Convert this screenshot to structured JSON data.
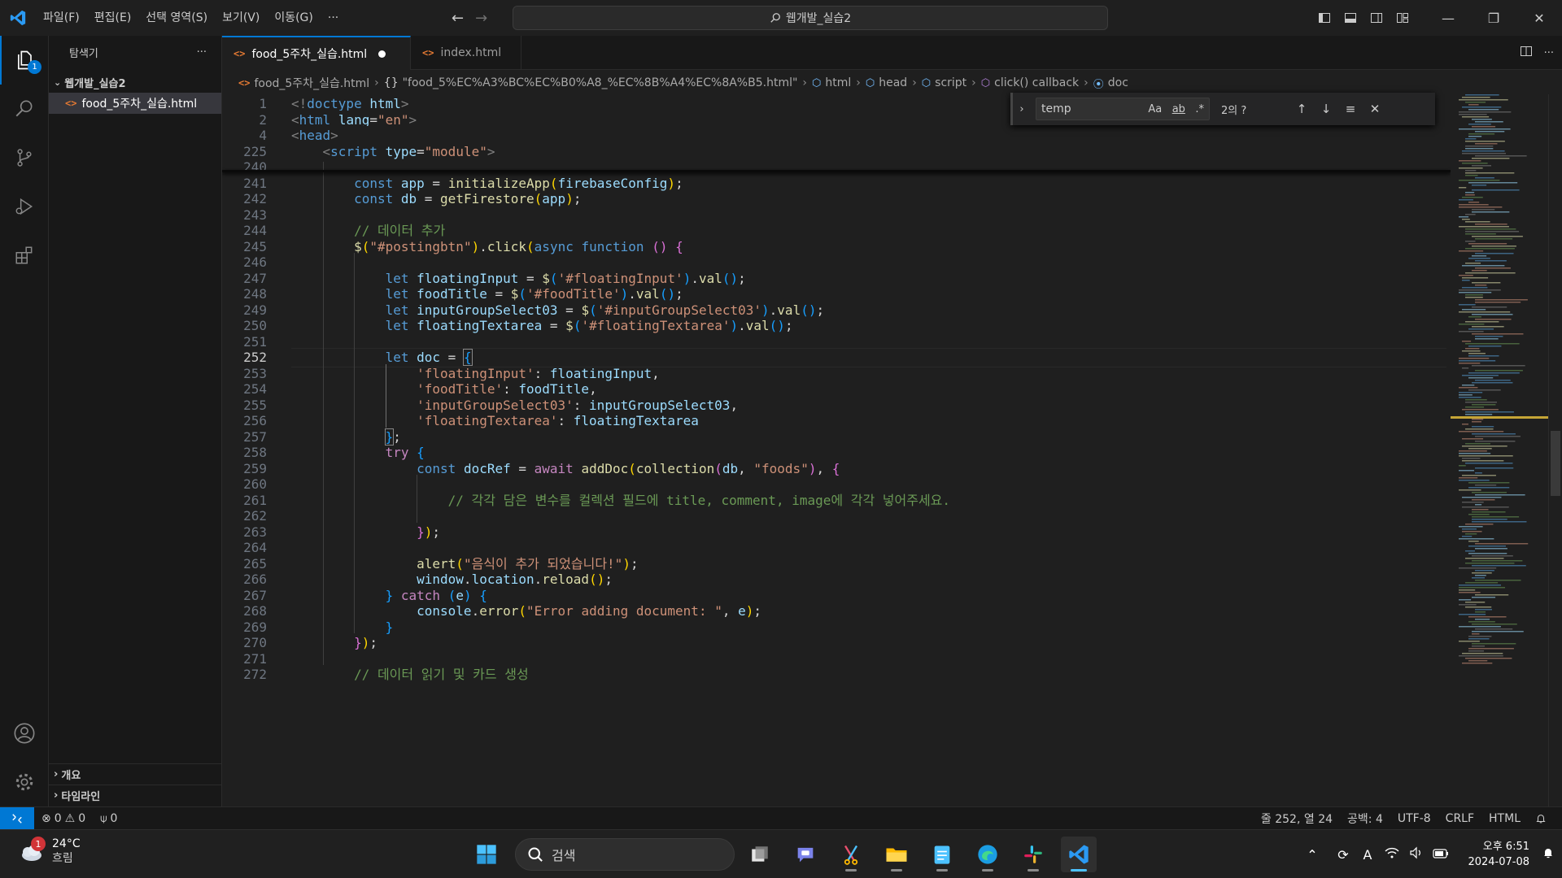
{
  "titlebar": {
    "menu": [
      "파일(F)",
      "편집(E)",
      "선택 영역(S)",
      "보기(V)",
      "이동(G)"
    ],
    "more": "···",
    "command_center": "웹개발_실습2"
  },
  "activitybar": {
    "explorer_badge": "1"
  },
  "sidebar": {
    "title": "탐색기",
    "more": "···",
    "folder": "웹개발_실습2",
    "file": "food_5주차_실습.html",
    "outline": "개요",
    "timeline": "타임라인"
  },
  "tabs": [
    {
      "label": "food_5주차_실습.html",
      "dirty": true
    },
    {
      "label": "index.html",
      "dirty": false
    }
  ],
  "breadcrumb": {
    "file": "food_5주차_실습.html",
    "object": "\"food_5%EC%A3%BC%EC%B0%A8_%EC%8B%A4%EC%8A%B5.html\"",
    "html": "html",
    "head": "head",
    "script": "script",
    "callback": "click() callback",
    "doc": "doc"
  },
  "find": {
    "query": "temp",
    "match_case": "Aa",
    "whole_word": "ab",
    "regex": ".*",
    "count": "2의 ?"
  },
  "editor": {
    "current_line": 252,
    "sticky": [
      {
        "n": "1",
        "parts": [
          [
            "pun",
            "<!"
          ],
          [
            "tag",
            "doctype"
          ],
          [
            "pl",
            " "
          ],
          [
            "attr",
            "html"
          ],
          [
            "pun",
            ">"
          ]
        ]
      },
      {
        "n": "2",
        "parts": [
          [
            "pun",
            "<"
          ],
          [
            "tag",
            "html"
          ],
          [
            "pl",
            " "
          ],
          [
            "attr",
            "lang"
          ],
          [
            "pl",
            "="
          ],
          [
            "str",
            "\"en\""
          ],
          [
            "pun",
            ">"
          ]
        ]
      },
      {
        "n": "4",
        "parts": [
          [
            "pun",
            "<"
          ],
          [
            "tag",
            "head"
          ],
          [
            "pun",
            ">"
          ]
        ]
      },
      {
        "n": "225",
        "parts": [
          [
            "pl",
            "    "
          ],
          [
            "pun",
            "<"
          ],
          [
            "tag",
            "script"
          ],
          [
            "pl",
            " "
          ],
          [
            "attr",
            "type"
          ],
          [
            "pl",
            "="
          ],
          [
            "str",
            "\"module\""
          ],
          [
            "pun",
            ">"
          ]
        ]
      }
    ],
    "lines": [
      {
        "n": "240",
        "parts": []
      },
      {
        "n": "241",
        "parts": [
          [
            "pl",
            "        "
          ],
          [
            "kw",
            "const"
          ],
          [
            "pl",
            " "
          ],
          [
            "var",
            "app"
          ],
          [
            "pl",
            " = "
          ],
          [
            "fn",
            "initializeApp"
          ],
          [
            "br1",
            "("
          ],
          [
            "var",
            "firebaseConfig"
          ],
          [
            "br1",
            ")"
          ],
          [
            "pl",
            ";"
          ]
        ]
      },
      {
        "n": "242",
        "parts": [
          [
            "pl",
            "        "
          ],
          [
            "kw",
            "const"
          ],
          [
            "pl",
            " "
          ],
          [
            "var",
            "db"
          ],
          [
            "pl",
            " = "
          ],
          [
            "fn",
            "getFirestore"
          ],
          [
            "br1",
            "("
          ],
          [
            "var",
            "app"
          ],
          [
            "br1",
            ")"
          ],
          [
            "pl",
            ";"
          ]
        ]
      },
      {
        "n": "243",
        "parts": []
      },
      {
        "n": "244",
        "parts": [
          [
            "pl",
            "        "
          ],
          [
            "cm",
            "// 데이터 추가"
          ]
        ]
      },
      {
        "n": "245",
        "parts": [
          [
            "pl",
            "        "
          ],
          [
            "fn",
            "$"
          ],
          [
            "br1",
            "("
          ],
          [
            "str",
            "\"#postingbtn\""
          ],
          [
            "br1",
            ")"
          ],
          [
            "pl",
            "."
          ],
          [
            "fn",
            "click"
          ],
          [
            "br1",
            "("
          ],
          [
            "kw",
            "async"
          ],
          [
            "pl",
            " "
          ],
          [
            "kw",
            "function"
          ],
          [
            "pl",
            " "
          ],
          [
            "br2",
            "()"
          ],
          [
            "pl",
            " "
          ],
          [
            "br2",
            "{"
          ]
        ]
      },
      {
        "n": "246",
        "parts": []
      },
      {
        "n": "247",
        "parts": [
          [
            "pl",
            "            "
          ],
          [
            "kw",
            "let"
          ],
          [
            "pl",
            " "
          ],
          [
            "var",
            "floatingInput"
          ],
          [
            "pl",
            " = "
          ],
          [
            "fn",
            "$"
          ],
          [
            "br3",
            "("
          ],
          [
            "str",
            "'#floatingInput'"
          ],
          [
            "br3",
            ")"
          ],
          [
            "pl",
            "."
          ],
          [
            "fn",
            "val"
          ],
          [
            "br3",
            "()"
          ],
          [
            "pl",
            ";"
          ]
        ]
      },
      {
        "n": "248",
        "parts": [
          [
            "pl",
            "            "
          ],
          [
            "kw",
            "let"
          ],
          [
            "pl",
            " "
          ],
          [
            "var",
            "foodTitle"
          ],
          [
            "pl",
            " = "
          ],
          [
            "fn",
            "$"
          ],
          [
            "br3",
            "("
          ],
          [
            "str",
            "'#foodTitle'"
          ],
          [
            "br3",
            ")"
          ],
          [
            "pl",
            "."
          ],
          [
            "fn",
            "val"
          ],
          [
            "br3",
            "()"
          ],
          [
            "pl",
            ";"
          ]
        ]
      },
      {
        "n": "249",
        "parts": [
          [
            "pl",
            "            "
          ],
          [
            "kw",
            "let"
          ],
          [
            "pl",
            " "
          ],
          [
            "var",
            "inputGroupSelect03"
          ],
          [
            "pl",
            " = "
          ],
          [
            "fn",
            "$"
          ],
          [
            "br3",
            "("
          ],
          [
            "str",
            "'#inputGroupSelect03'"
          ],
          [
            "br3",
            ")"
          ],
          [
            "pl",
            "."
          ],
          [
            "fn",
            "val"
          ],
          [
            "br3",
            "()"
          ],
          [
            "pl",
            ";"
          ]
        ]
      },
      {
        "n": "250",
        "parts": [
          [
            "pl",
            "            "
          ],
          [
            "kw",
            "let"
          ],
          [
            "pl",
            " "
          ],
          [
            "var",
            "floatingTextarea"
          ],
          [
            "pl",
            " = "
          ],
          [
            "fn",
            "$"
          ],
          [
            "br3",
            "("
          ],
          [
            "str",
            "'#floatingTextarea'"
          ],
          [
            "br3",
            ")"
          ],
          [
            "pl",
            "."
          ],
          [
            "fn",
            "val"
          ],
          [
            "br3",
            "()"
          ],
          [
            "pl",
            ";"
          ]
        ]
      },
      {
        "n": "251",
        "parts": []
      },
      {
        "n": "252",
        "parts": [
          [
            "pl",
            "            "
          ],
          [
            "kw",
            "let"
          ],
          [
            "pl",
            " "
          ],
          [
            "var",
            "doc"
          ],
          [
            "pl",
            " = "
          ],
          [
            "br3m",
            "{"
          ]
        ]
      },
      {
        "n": "253",
        "parts": [
          [
            "pl",
            "                "
          ],
          [
            "str",
            "'floatingInput'"
          ],
          [
            "pl",
            ": "
          ],
          [
            "var",
            "floatingInput"
          ],
          [
            "pl",
            ","
          ]
        ]
      },
      {
        "n": "254",
        "parts": [
          [
            "pl",
            "                "
          ],
          [
            "str",
            "'foodTitle'"
          ],
          [
            "pl",
            ": "
          ],
          [
            "var",
            "foodTitle"
          ],
          [
            "pl",
            ","
          ]
        ]
      },
      {
        "n": "255",
        "parts": [
          [
            "pl",
            "                "
          ],
          [
            "str",
            "'inputGroupSelect03'"
          ],
          [
            "pl",
            ": "
          ],
          [
            "var",
            "inputGroupSelect03"
          ],
          [
            "pl",
            ","
          ]
        ]
      },
      {
        "n": "256",
        "parts": [
          [
            "pl",
            "                "
          ],
          [
            "str",
            "'floatingTextarea'"
          ],
          [
            "pl",
            ": "
          ],
          [
            "var",
            "floatingTextarea"
          ]
        ]
      },
      {
        "n": "257",
        "parts": [
          [
            "pl",
            "            "
          ],
          [
            "br3m",
            "}"
          ],
          [
            "pl",
            ";"
          ]
        ]
      },
      {
        "n": "258",
        "parts": [
          [
            "pl",
            "            "
          ],
          [
            "ctl",
            "try"
          ],
          [
            "pl",
            " "
          ],
          [
            "br3",
            "{"
          ]
        ]
      },
      {
        "n": "259",
        "parts": [
          [
            "pl",
            "                "
          ],
          [
            "kw",
            "const"
          ],
          [
            "pl",
            " "
          ],
          [
            "var",
            "docRef"
          ],
          [
            "pl",
            " = "
          ],
          [
            "ctl",
            "await"
          ],
          [
            "pl",
            " "
          ],
          [
            "fn",
            "addDoc"
          ],
          [
            "br1",
            "("
          ],
          [
            "fn",
            "collection"
          ],
          [
            "br2",
            "("
          ],
          [
            "var",
            "db"
          ],
          [
            "pl",
            ", "
          ],
          [
            "str",
            "\"foods\""
          ],
          [
            "br2",
            ")"
          ],
          [
            "pl",
            ", "
          ],
          [
            "br2",
            "{"
          ]
        ]
      },
      {
        "n": "260",
        "parts": []
      },
      {
        "n": "261",
        "parts": [
          [
            "pl",
            "                    "
          ],
          [
            "cm",
            "// 각각 담은 변수를 컬렉션 필드에 title, comment, image에 각각 넣어주세요."
          ]
        ]
      },
      {
        "n": "262",
        "parts": []
      },
      {
        "n": "263",
        "parts": [
          [
            "pl",
            "                "
          ],
          [
            "br2",
            "}"
          ],
          [
            "br1",
            ")"
          ],
          [
            "pl",
            ";"
          ]
        ]
      },
      {
        "n": "264",
        "parts": []
      },
      {
        "n": "265",
        "parts": [
          [
            "pl",
            "                "
          ],
          [
            "fn",
            "alert"
          ],
          [
            "br1",
            "("
          ],
          [
            "str",
            "\"음식이 추가 되었습니다!\""
          ],
          [
            "br1",
            ")"
          ],
          [
            "pl",
            ";"
          ]
        ]
      },
      {
        "n": "266",
        "parts": [
          [
            "pl",
            "                "
          ],
          [
            "var",
            "window"
          ],
          [
            "pl",
            "."
          ],
          [
            "var",
            "location"
          ],
          [
            "pl",
            "."
          ],
          [
            "fn",
            "reload"
          ],
          [
            "br1",
            "()"
          ],
          [
            "pl",
            ";"
          ]
        ]
      },
      {
        "n": "267",
        "parts": [
          [
            "pl",
            "            "
          ],
          [
            "br3",
            "}"
          ],
          [
            "pl",
            " "
          ],
          [
            "ctl",
            "catch"
          ],
          [
            "pl",
            " "
          ],
          [
            "br3",
            "("
          ],
          [
            "var",
            "e"
          ],
          [
            "br3",
            ")"
          ],
          [
            "pl",
            " "
          ],
          [
            "br3",
            "{"
          ]
        ]
      },
      {
        "n": "268",
        "parts": [
          [
            "pl",
            "                "
          ],
          [
            "var",
            "console"
          ],
          [
            "pl",
            "."
          ],
          [
            "fn",
            "error"
          ],
          [
            "br1",
            "("
          ],
          [
            "str",
            "\"Error adding document: \""
          ],
          [
            "pl",
            ", "
          ],
          [
            "var",
            "e"
          ],
          [
            "br1",
            ")"
          ],
          [
            "pl",
            ";"
          ]
        ]
      },
      {
        "n": "269",
        "parts": [
          [
            "pl",
            "            "
          ],
          [
            "br3",
            "}"
          ]
        ]
      },
      {
        "n": "270",
        "parts": [
          [
            "pl",
            "        "
          ],
          [
            "br2",
            "}"
          ],
          [
            "br1",
            ")"
          ],
          [
            "pl",
            ";"
          ]
        ]
      },
      {
        "n": "271",
        "parts": []
      },
      {
        "n": "272",
        "parts": [
          [
            "pl",
            "        "
          ],
          [
            "cm",
            "// 데이터 읽기 및 카드 생성"
          ]
        ]
      }
    ]
  },
  "statusbar": {
    "errors": "0",
    "warnings": "0",
    "ports": "0",
    "position": "줄 252, 열 24",
    "indent": "공백: 4",
    "encoding": "UTF-8",
    "eol": "CRLF",
    "language": "HTML"
  },
  "taskbar": {
    "weather_temp": "24°C",
    "weather_desc": "흐림",
    "weather_badge": "1",
    "search_placeholder": "검색",
    "clock_time": "오후 6:51",
    "clock_date": "2024-07-08",
    "ime": "A"
  }
}
